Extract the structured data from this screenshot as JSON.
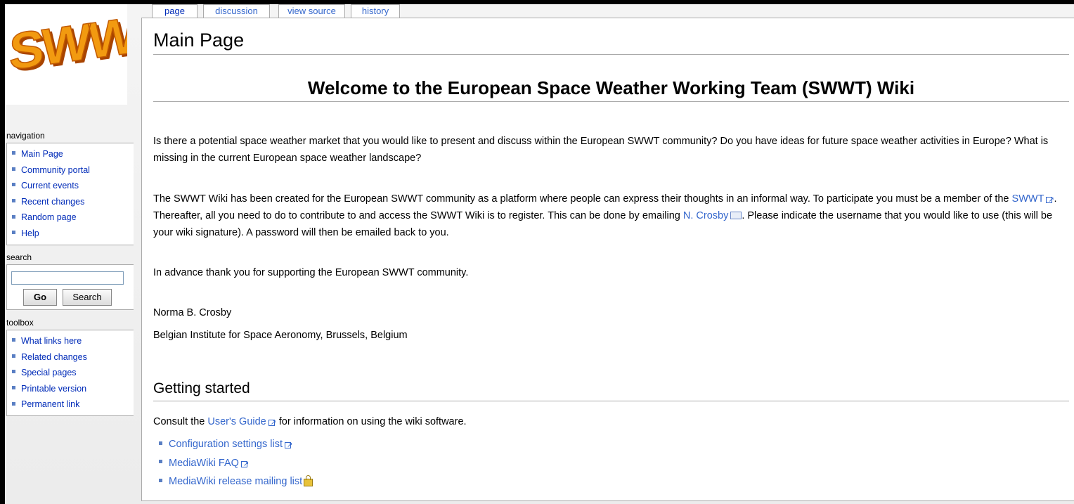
{
  "tabs": {
    "page": "page",
    "discussion": "discussion",
    "view_source": "view source",
    "history": "history"
  },
  "logo": {
    "text": "SWWT"
  },
  "navigation": {
    "title": "navigation",
    "items": [
      "Main Page",
      "Community portal",
      "Current events",
      "Recent changes",
      "Random page",
      "Help"
    ]
  },
  "search": {
    "title": "search",
    "value": "",
    "go_label": "Go",
    "search_label": "Search"
  },
  "toolbox": {
    "title": "toolbox",
    "items": [
      "What links here",
      "Related changes",
      "Special pages",
      "Printable version",
      "Permanent link"
    ]
  },
  "main": {
    "title": "Main Page",
    "welcome": "Welcome to the European Space Weather Working Team (SWWT) Wiki",
    "p1": "Is there a potential space weather market that you would like to present and discuss within the European SWWT community? Do you have ideas for future space weather activities in Europe? What is missing in the current European space weather landscape?",
    "p2_a": "The SWWT Wiki has been created for the European SWWT community as a platform where people can express their thoughts in an informal way. To participate you must be a member of the ",
    "p2_link1": "SWWT",
    "p2_b": ". Thereafter, all you need to do to contribute to and access the SWWT Wiki is to register. This can be done by emailing ",
    "p2_link2": "N. Crosby",
    "p2_c": ". Please indicate the username that you would like to use (this will be your wiki signature). A password will then be emailed back to you.",
    "p3": "In advance thank you for supporting the European SWWT community.",
    "sig_name": "Norma B. Crosby",
    "sig_org": "Belgian Institute for Space Aeronomy, Brussels, Belgium",
    "getting_started": "Getting started",
    "consult_a": "Consult the ",
    "consult_link": "User's Guide",
    "consult_b": " for information on using the wiki software.",
    "links": [
      "Configuration settings list",
      "MediaWiki FAQ",
      "MediaWiki release mailing list"
    ]
  }
}
